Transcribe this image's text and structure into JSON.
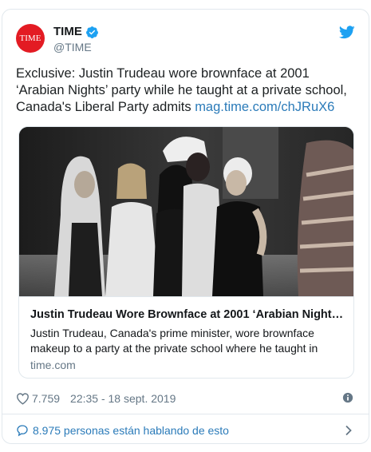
{
  "account": {
    "display_name": "TIME",
    "handle": "@TIME",
    "avatar_text": "TIME",
    "avatar_color": "#e31b23",
    "verified_icon": "verified-badge-icon",
    "platform_icon": "twitter-bird-icon"
  },
  "tweet": {
    "text": "Exclusive: Justin Trudeau wore brownface at 2001 ‘Arabian Nights’ party while he taught at a private school, Canada's Liberal Party admits ",
    "link": "mag.time.com/chJRuX6"
  },
  "card": {
    "title": "Justin Trudeau Wore Brownface at 2001 ‘Arabian Nights’…",
    "description": "Justin Trudeau, Canada's prime minister, wore brownface makeup to a party at the private school where he taught in",
    "domain": "time.com"
  },
  "meta": {
    "likes": "7.759",
    "timestamp": "22:35 - 18 sept. 2019"
  },
  "footer": {
    "talking": "8.975 personas están hablando de esto"
  },
  "colors": {
    "link": "#2b7bb9",
    "secondary_text": "#657786",
    "border": "#e1e8ed",
    "twitter_blue": "#1da1f2"
  }
}
